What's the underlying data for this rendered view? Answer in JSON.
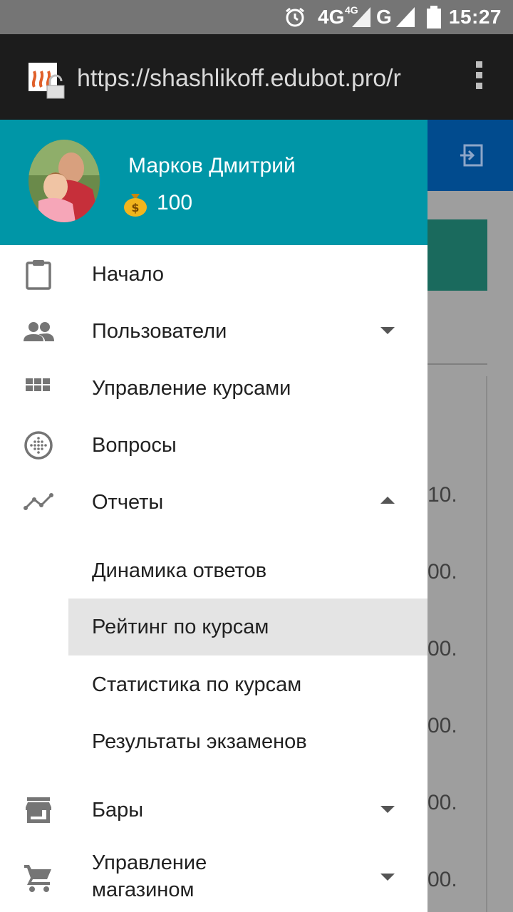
{
  "status_bar": {
    "network": "4G",
    "network_small": "4G",
    "network2": "G",
    "time": "15:27"
  },
  "browser": {
    "url": "https://shashlikoff.edubot.pro/r"
  },
  "profile": {
    "name": "Марков Дмитрий",
    "coins": "100"
  },
  "background_page": {
    "values": [
      ".10",
      ".00",
      ".00",
      ".00",
      ".00",
      ".00"
    ]
  },
  "menu": {
    "items": [
      {
        "label": "Начало",
        "icon": "clipboard-icon"
      },
      {
        "label": "Пользователи",
        "icon": "people-icon",
        "expandable": true
      },
      {
        "label": "Управление курсами",
        "icon": "grid-icon"
      },
      {
        "label": "Вопросы",
        "icon": "dots-circle-icon"
      },
      {
        "label": "Отчеты",
        "icon": "trend-line-icon",
        "expanded": true
      }
    ],
    "reports_sub": [
      {
        "label": "Динамика ответов"
      },
      {
        "label": "Рейтинг по курсам",
        "active": true
      },
      {
        "label": "Статистика по курсам"
      },
      {
        "label": "Результаты экзаменов"
      }
    ],
    "bottom_items": [
      {
        "label": "Бары",
        "icon": "store-icon"
      },
      {
        "label": "Управление магазином",
        "label_line1": "Управление",
        "label_line2": "магазином",
        "icon": "cart-icon"
      }
    ]
  },
  "colors": {
    "drawer_header": "#0096a7",
    "app_header": "#014b8e",
    "active_item": "#e4e4e4"
  }
}
